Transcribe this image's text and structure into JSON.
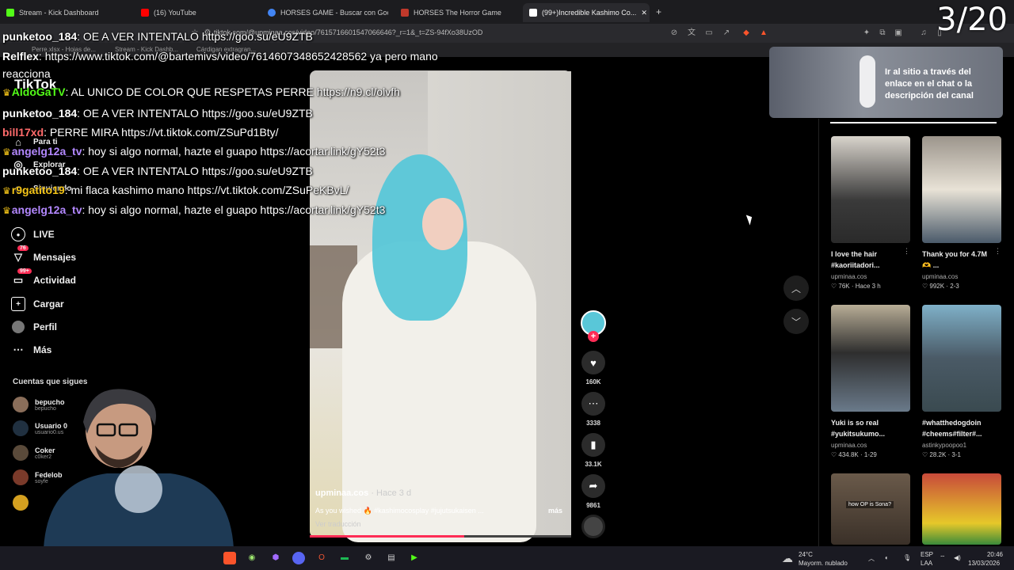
{
  "browser": {
    "tabs": [
      {
        "label": "Stream - Kick Dashboard",
        "color": "#53fc18"
      },
      {
        "label": "(16) YouTube",
        "color": "#ff0000"
      },
      {
        "label": "HORSES GAME - Buscar con Google",
        "color": "#4285f4"
      },
      {
        "label": "HORSES The Horror Game",
        "color": "#c0392b"
      },
      {
        "label": "(99+)Incredible Kashimo Co...",
        "color": "#ffffff"
      }
    ],
    "url": "tiktok.com/@upminaa.cos/video/7615716601547066646?_r=1&_t=ZS-94fXo38UzOD",
    "bookmarks": [
      "Perre.xlsx - Hojas de...",
      "Stream - Kick Dashb...",
      "Cárdigan extragran..."
    ]
  },
  "stream_counter": "3/20",
  "chat": [
    {
      "user": "punketoo_184",
      "text": "OE A VER INTENTALO https://goo.su/eU9ZTB",
      "color": "#ffffff",
      "crown": false
    },
    {
      "user": "Relflex",
      "text": "https://www.tiktok.com/@bartemivs/video/7614607348652428562 ya pero mano",
      "color": "#ffffff",
      "crown": false
    },
    {
      "user": "",
      "text": "reacciona",
      "color": "#ffffff",
      "crown": false
    },
    {
      "user": "AldoGaTV",
      "text": "AL UNICO DE COLOR QUE RESPETAS PERRE https://n9.cl/olvfh",
      "color": "#53fc18",
      "crown": true
    },
    {
      "user": "punketoo_184",
      "text": "OE A VER INTENTALO https://goo.su/eU9ZTB",
      "color": "#ffffff",
      "crown": false
    },
    {
      "user": "bill17xd",
      "text": "PERRE MIRA https://vt.tiktok.com/ZSuPd1Bty/",
      "color": "#ff6b6b",
      "crown": false
    },
    {
      "user": "angelg12a_tv",
      "text": "hoy si algo normal, hazte el guapo https://acortar.link/gY52t3",
      "color": "#b388ff",
      "crown": true
    },
    {
      "user": "punketoo_184",
      "text": "OE A VER INTENTALO https://goo.su/eU9ZTB",
      "color": "#ffffff",
      "crown": false
    },
    {
      "user": "r9gatito19",
      "text": "mi flaca kashimo mano https://vt.tiktok.com/ZSuPeKBvL/",
      "color": "#f5c518",
      "crown": true
    },
    {
      "user": "angelg12a_tv",
      "text": "hoy si algo normal, hazte el guapo https://acortar.link/gY52t3",
      "color": "#b388ff",
      "crown": true
    }
  ],
  "sidebar": {
    "logo": "TikTok",
    "items": [
      {
        "label": "Para ti",
        "icon": "home-icon"
      },
      {
        "label": "Explorar",
        "icon": "compass-icon"
      },
      {
        "label": "Siguiendo",
        "icon": "following-icon"
      },
      {
        "label": "LIVE",
        "icon": "live-icon"
      },
      {
        "label": "Mensajes",
        "icon": "message-icon",
        "badge": "76"
      },
      {
        "label": "Actividad",
        "icon": "activity-icon",
        "badge": "99+"
      },
      {
        "label": "Cargar",
        "icon": "upload-icon"
      },
      {
        "label": "Perfil",
        "icon": "profile-icon"
      },
      {
        "label": "Más",
        "icon": "more-icon"
      }
    ],
    "following_title": "Cuentas que sigues",
    "following": [
      {
        "name": "bepucho",
        "handle": "bepucho"
      },
      {
        "name": "Usuario 0",
        "handle": "usuario0.us"
      },
      {
        "name": "Coker",
        "handle": "c0ker2"
      },
      {
        "name": "Fedelob",
        "handle": "soyfe"
      }
    ]
  },
  "video": {
    "author": "upminaa.cos",
    "time": "· Hace 3 d",
    "caption": "As you wished 🔥 #kashimocosplay #jujutsukaisen ...",
    "more": "más",
    "translate": "Ver traducción",
    "progress": 0.59,
    "actions": [
      {
        "icon": "heart-icon",
        "count": "160K"
      },
      {
        "icon": "comment-icon",
        "count": "3338"
      },
      {
        "icon": "bookmark-icon",
        "count": "33.1K"
      },
      {
        "icon": "share-icon",
        "count": "9861"
      }
    ]
  },
  "ad": {
    "text": "Ir al sitio a través del enlace en el chat o la descripción del canal"
  },
  "recommended": [
    {
      "title": "I love the hair #kaoriitadori...",
      "author": "upminaa.cos",
      "stats": "♡ 76K · Hace 3 h",
      "color": "#3a3a3a"
    },
    {
      "title": "Thank you for 4.7M 🫶 ...",
      "author": "upminaa.cos",
      "stats": "♡ 992K · 2-3",
      "color": "#6f6a62"
    },
    {
      "title": "Yuki is so real #yukitsukumo...",
      "author": "upminaa.cos",
      "stats": "♡ 434.8K · 1-29",
      "color": "#7a6f58"
    },
    {
      "title": "#whatthedogdoin #cheems#filter#...",
      "author": "astinkypoopoo1",
      "stats": "♡ 28.2K · 3-1",
      "color": "#5f7380"
    },
    {
      "title": "",
      "author": "",
      "stats": "",
      "caption": "how OP is Sona?",
      "color": "#4a4038"
    },
    {
      "title": "",
      "author": "",
      "stats": "",
      "color": "#b23a3a"
    }
  ],
  "taskbar": {
    "weather_temp": "24°C",
    "weather_desc": "Mayorm. nublado",
    "lang": "ESP",
    "region": "LAA",
    "time": "20:46",
    "date": "13/03/2026"
  }
}
